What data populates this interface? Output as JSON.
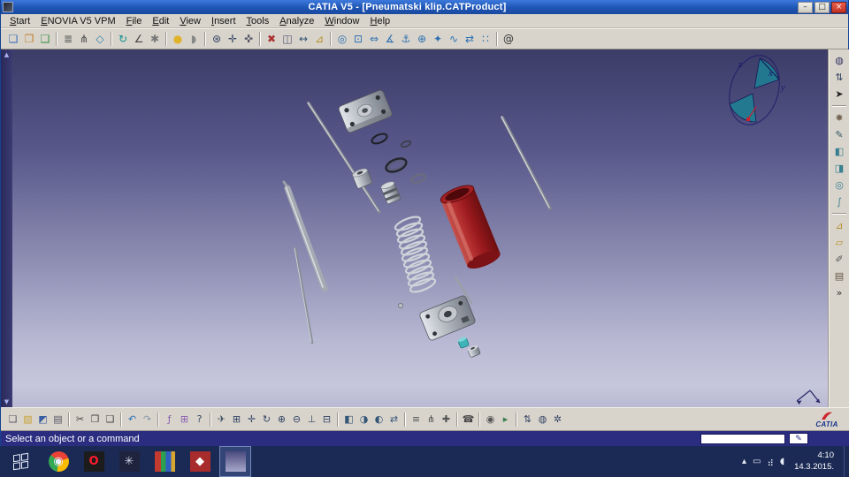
{
  "window": {
    "title": "CATIA V5 - [Pneumatski klip.CATProduct]",
    "controls": {
      "minimize": "–",
      "maximize": "□",
      "close": "×"
    }
  },
  "menu": {
    "items": [
      "Start",
      "ENOVIA V5 VPM",
      "File",
      "Edit",
      "View",
      "Insert",
      "Tools",
      "Analyze",
      "Window",
      "Help"
    ]
  },
  "toolbar_top": {
    "groups": [
      [
        {
          "name": "vpm-save-icon",
          "glyph": "❏",
          "fg": "#3a6fc0"
        },
        {
          "name": "vpm-open-icon",
          "glyph": "❐",
          "fg": "#c07f2a"
        },
        {
          "name": "vpm-work-icon",
          "glyph": "❑",
          "fg": "#3a8f4a"
        }
      ],
      [
        {
          "name": "product-structure-icon",
          "glyph": "≣",
          "fg": "#555555"
        },
        {
          "name": "graph-tree-icon",
          "glyph": "⋔",
          "fg": "#444444"
        },
        {
          "name": "component-list-icon",
          "glyph": "◇",
          "fg": "#2b7fb3"
        }
      ],
      [
        {
          "name": "update-assembly-icon",
          "glyph": "↻",
          "fg": "#0f8f8f"
        },
        {
          "name": "degrees-of-freedom-icon",
          "glyph": "∠",
          "fg": "#444444"
        },
        {
          "name": "mechanism-icon",
          "glyph": "✱",
          "fg": "#777777"
        }
      ],
      [
        {
          "name": "apply-material-icon",
          "glyph": "●",
          "fg": "#e0b32a"
        },
        {
          "name": "render-view-icon",
          "glyph": "◗",
          "fg": "#888888"
        }
      ],
      [
        {
          "name": "snap-icon",
          "glyph": "⊛",
          "fg": "#334466"
        },
        {
          "name": "smart-move-icon",
          "glyph": "✛",
          "fg": "#334466"
        },
        {
          "name": "manipulate-icon",
          "glyph": "✜",
          "fg": "#555566"
        }
      ],
      [
        {
          "name": "clash-analysis-icon",
          "glyph": "✖",
          "fg": "#aa3333"
        },
        {
          "name": "sectioning-icon",
          "glyph": "◫",
          "fg": "#555577"
        },
        {
          "name": "distance-analysis-icon",
          "glyph": "↔",
          "fg": "#335577"
        },
        {
          "name": "measure-icon",
          "glyph": "⊿",
          "fg": "#b58f2a"
        }
      ],
      [
        {
          "name": "coincidence-constraint-icon",
          "glyph": "◎",
          "fg": "#2b6fb3"
        },
        {
          "name": "contact-constraint-icon",
          "glyph": "⊡",
          "fg": "#2b6fb3"
        },
        {
          "name": "offset-constraint-icon",
          "glyph": "⇔",
          "fg": "#2b6fb3"
        },
        {
          "name": "angle-constraint-icon",
          "glyph": "∡",
          "fg": "#2b6fb3"
        },
        {
          "name": "anchor-constraint-icon",
          "glyph": "⚓",
          "fg": "#2b6fb3"
        },
        {
          "name": "fix-together-icon",
          "glyph": "⊕",
          "fg": "#2b6fb3"
        },
        {
          "name": "quick-constraint-icon",
          "glyph": "✦",
          "fg": "#2b6fb3"
        },
        {
          "name": "flexible-rigid-icon",
          "glyph": "∿",
          "fg": "#2b6fb3"
        },
        {
          "name": "change-constraint-icon",
          "glyph": "⇄",
          "fg": "#2b6fb3"
        },
        {
          "name": "reuse-pattern-icon",
          "glyph": "∷",
          "fg": "#2b6fb3"
        }
      ],
      [
        {
          "name": "catia-website-icon",
          "glyph": "@",
          "fg": "#333333"
        }
      ]
    ]
  },
  "right_toolbar": {
    "groups": [
      [
        {
          "name": "enovia-connect-icon",
          "glyph": "◍",
          "fg": "#333366"
        },
        {
          "name": "data-exchange-icon",
          "glyph": "⇅",
          "fg": "#334466"
        },
        {
          "name": "select-arrow-icon",
          "glyph": "➤",
          "fg": "#222222"
        }
      ],
      [
        {
          "name": "explode-assembly-icon",
          "glyph": "✸",
          "fg": "#776655"
        },
        {
          "name": "sketcher-icon",
          "glyph": "✎",
          "fg": "#335566"
        },
        {
          "name": "pad-icon",
          "glyph": "◧",
          "fg": "#3a7f8f"
        },
        {
          "name": "pocket-icon",
          "glyph": "◨",
          "fg": "#3a7f8f"
        },
        {
          "name": "shaft-icon",
          "glyph": "◎",
          "fg": "#3a7f8f"
        },
        {
          "name": "rib-icon",
          "glyph": "∫",
          "fg": "#3a7f8f"
        }
      ],
      [
        {
          "name": "measure-between-icon",
          "glyph": "⊿",
          "fg": "#b58f2a"
        },
        {
          "name": "measure-item-icon",
          "glyph": "▱",
          "fg": "#b58f2a"
        },
        {
          "name": "annotation-icon",
          "glyph": "✐",
          "fg": "#555555"
        },
        {
          "name": "catalog-browser-icon",
          "glyph": "▤",
          "fg": "#665544"
        },
        {
          "name": "more-toolbars-chevron",
          "glyph": "»",
          "fg": "#333333"
        }
      ]
    ]
  },
  "toolbar_bottom": {
    "groups": [
      [
        {
          "name": "new-document-icon",
          "glyph": "❏",
          "fg": "#555566"
        },
        {
          "name": "open-icon",
          "glyph": "▨",
          "fg": "#c9a23a"
        },
        {
          "name": "save-icon",
          "glyph": "◩",
          "fg": "#3a5fa0"
        },
        {
          "name": "print-icon",
          "glyph": "▤",
          "fg": "#555566"
        }
      ],
      [
        {
          "name": "cut-icon",
          "glyph": "✂",
          "fg": "#444444"
        },
        {
          "name": "copy-icon",
          "glyph": "❐",
          "fg": "#444444"
        },
        {
          "name": "paste-icon",
          "glyph": "❑",
          "fg": "#444444"
        }
      ],
      [
        {
          "name": "undo-icon",
          "glyph": "↶",
          "fg": "#2b6fb3"
        },
        {
          "name": "redo-icon",
          "glyph": "↷",
          "fg": "#8899aa"
        }
      ],
      [
        {
          "name": "formula-icon",
          "glyph": "ƒ",
          "fg": "#8a5fb0"
        },
        {
          "name": "design-table-icon",
          "glyph": "⊞",
          "fg": "#8a5fb0"
        },
        {
          "name": "help-icon",
          "glyph": "?",
          "fg": "#334466"
        }
      ],
      [
        {
          "name": "fly-mode-icon",
          "glyph": "✈",
          "fg": "#445566"
        },
        {
          "name": "fit-all-in-icon",
          "glyph": "⊞",
          "fg": "#334466"
        },
        {
          "name": "pan-icon",
          "glyph": "✛",
          "fg": "#334466"
        },
        {
          "name": "rotate-icon",
          "glyph": "↻",
          "fg": "#334466"
        },
        {
          "name": "zoom-in-icon",
          "glyph": "⊕",
          "fg": "#334466"
        },
        {
          "name": "zoom-out-icon",
          "glyph": "⊖",
          "fg": "#334466"
        },
        {
          "name": "normal-view-icon",
          "glyph": "⊥",
          "fg": "#334466"
        },
        {
          "name": "multi-view-icon",
          "glyph": "⊟",
          "fg": "#334466"
        }
      ],
      [
        {
          "name": "isometric-view-icon",
          "glyph": "◧",
          "fg": "#335577"
        },
        {
          "name": "shading-style-icon",
          "glyph": "◑",
          "fg": "#335577"
        },
        {
          "name": "hide-show-icon",
          "glyph": "◐",
          "fg": "#335577"
        },
        {
          "name": "swap-visible-space-icon",
          "glyph": "⇄",
          "fg": "#335577"
        }
      ],
      [
        {
          "name": "graph-icon",
          "glyph": "≡",
          "fg": "#555555"
        },
        {
          "name": "specification-tree-icon",
          "glyph": "⋔",
          "fg": "#555555"
        },
        {
          "name": "reframe-icon",
          "glyph": "✚",
          "fg": "#555555"
        }
      ],
      [
        {
          "name": "telephone-support-icon",
          "glyph": "☎",
          "fg": "#444444"
        }
      ],
      [
        {
          "name": "capture-icon",
          "glyph": "◉",
          "fg": "#555555"
        },
        {
          "name": "player-icon",
          "glyph": "▸",
          "fg": "#3a7f4f"
        }
      ],
      [
        {
          "name": "exchange-icon",
          "glyph": "⇅",
          "fg": "#334466"
        },
        {
          "name": "browser-icon",
          "glyph": "◍",
          "fg": "#334466"
        },
        {
          "name": "options-icon",
          "glyph": "✲",
          "fg": "#334466"
        }
      ]
    ]
  },
  "viewport": {
    "compass": {
      "z": "z",
      "x": "x",
      "y": "y"
    },
    "scrollbar": {
      "up": "▲",
      "down": "▼"
    },
    "colors": {
      "background_top": "#3c3c68",
      "background_bottom": "#c6c6dc",
      "cylinder_red": "#a02024",
      "metal_gray": "#a9afb7",
      "spring_gray": "#d3d6db",
      "fitting_teal": "#3fb3b8"
    }
  },
  "status_bar": {
    "message": "Select an object or a command",
    "pad_glyph": "✎"
  },
  "branding": {
    "logo_text": "CATIA"
  },
  "taskbar": {
    "apps": [
      {
        "name": "chrome-icon",
        "glyph": "◉",
        "fg": "#e8f0fe",
        "bg": "conic-gradient(from -50deg, #ea4335 0 120deg, #fbbc05 0 240deg, #34a853 0 360deg)",
        "round": true
      },
      {
        "name": "opera-icon",
        "glyph": "O",
        "fg": "#ff1b2d",
        "bg": "#1c1c1c",
        "bold": true
      },
      {
        "name": "media-player-icon",
        "glyph": "✳",
        "fg": "#cfd6ea",
        "bg": "#20233d"
      },
      {
        "name": "photo-library-icon",
        "glyph": "",
        "bg": "linear-gradient(90deg,#c23b2e 0 30%,#2e9e4f 30% 55%,#2e5fc2 55% 80%,#d8a62e 80% 100%)"
      },
      {
        "name": "pdf-reader-icon",
        "glyph": "◆",
        "fg": "#ffffff",
        "bg": "#a82c2c"
      },
      {
        "name": "catia-taskbar-button",
        "glyph": "",
        "bg": "linear-gradient(180deg,#4a4a7e,#a8a8cc)",
        "active": true
      }
    ],
    "tray_icons": [
      {
        "name": "show-hidden-icons-button",
        "glyph": "▴"
      },
      {
        "name": "action-center-icon",
        "glyph": "▭"
      },
      {
        "name": "network-tray-icon",
        "glyph": "⣴"
      },
      {
        "name": "volume-tray-icon",
        "glyph": "◖"
      }
    ],
    "clock": {
      "time": "4:10",
      "date": "14.3.2015."
    }
  }
}
